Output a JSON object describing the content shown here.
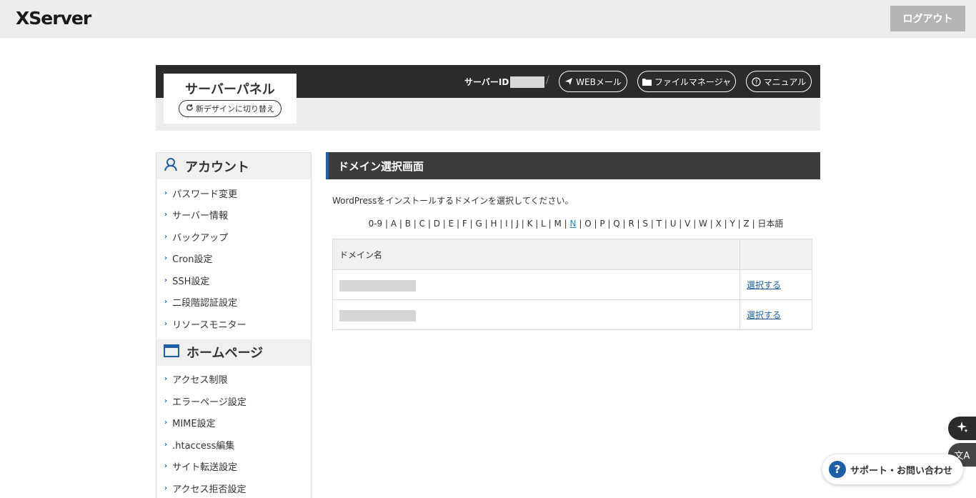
{
  "topbar": {
    "logo_x": "X",
    "logo_rest": "Server",
    "logout_label": "ログアウト"
  },
  "panel": {
    "title": "サーバーパネル",
    "switch_label": "新デザインに切り替え",
    "server_id_label": "サーバーID",
    "separator": "/",
    "webmail_label": "WEBメール",
    "filemanager_label": "ファイルマネージャ",
    "manual_label": "マニュアル"
  },
  "sidebar": {
    "account_title": "アカウント",
    "account_items": [
      "パスワード変更",
      "サーバー情報",
      "バックアップ",
      "Cron設定",
      "SSH設定",
      "二段階認証設定",
      "リソースモニター"
    ],
    "home_title": "ホームページ",
    "home_items": [
      "アクセス制限",
      "エラーページ設定",
      "MIME設定",
      ".htaccess編集",
      "サイト転送設定",
      "アクセス拒否設定"
    ]
  },
  "main": {
    "title": "ドメイン選択画面",
    "instruction": "WordPressをインストールするドメインを選択してください。",
    "alphabet": [
      "0-9",
      "A",
      "B",
      "C",
      "D",
      "E",
      "F",
      "G",
      "H",
      "I",
      "J",
      "K",
      "L",
      "M",
      "N",
      "O",
      "P",
      "Q",
      "R",
      "S",
      "T",
      "U",
      "V",
      "W",
      "X",
      "Y",
      "Z",
      "日本語"
    ],
    "active_letter": "N",
    "table_header_domain": "ドメイン名",
    "table_header_action": "",
    "rows": [
      {
        "action": "選択する"
      },
      {
        "action": "選択する"
      }
    ]
  },
  "floating": {
    "support_label": "サポート・お問い合わせ",
    "support_q": "?",
    "translate_glyph": "文A"
  },
  "colors": {
    "accent": "#1e5fa8",
    "header_dark": "#2b2b2b",
    "active_link": "#1e88c8"
  }
}
